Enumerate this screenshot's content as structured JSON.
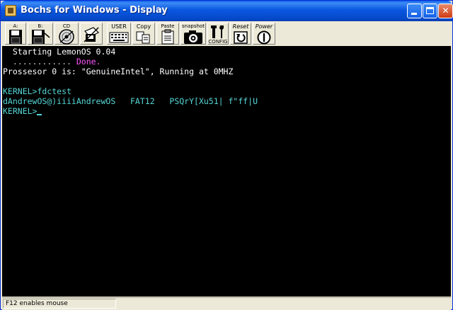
{
  "window": {
    "title": "Bochs for Windows - Display"
  },
  "toolbar": {
    "floppy_a_label": "A:",
    "floppy_b_label": "B:",
    "cdrom_label": "CD",
    "user_label": "USER",
    "copy_label": "Copy",
    "paste_label": "Paste",
    "snapshot_label": "snapshot",
    "config_label": "CONFIG",
    "reset_label": "Reset",
    "power_label": "Power"
  },
  "console": {
    "lines": [
      {
        "text": "  Starting LemonOS 0.04",
        "color": "#ffffff"
      },
      {
        "text": "  ............",
        "color": "#c8c8c8",
        "extra": " Done.",
        "extra_color": "#ff55ff"
      },
      {
        "text": "Prossesor 0 is: \"GenuineIntel\", Running at 0MHZ",
        "color": "#ffffff"
      },
      {
        "text": "",
        "color": "#ffffff"
      },
      {
        "text": "KERNEL>fdctest",
        "color": "#56d6d6"
      },
      {
        "text": "dAndrewOS@)iiiiAndrewOS   FAT12   PSQrY[Xu51| f\"ff|U",
        "color": "#56d6d6"
      },
      {
        "text": "KERNEL>",
        "color": "#56d6d6"
      }
    ]
  },
  "status": {
    "text": "F12 enables mouse"
  }
}
